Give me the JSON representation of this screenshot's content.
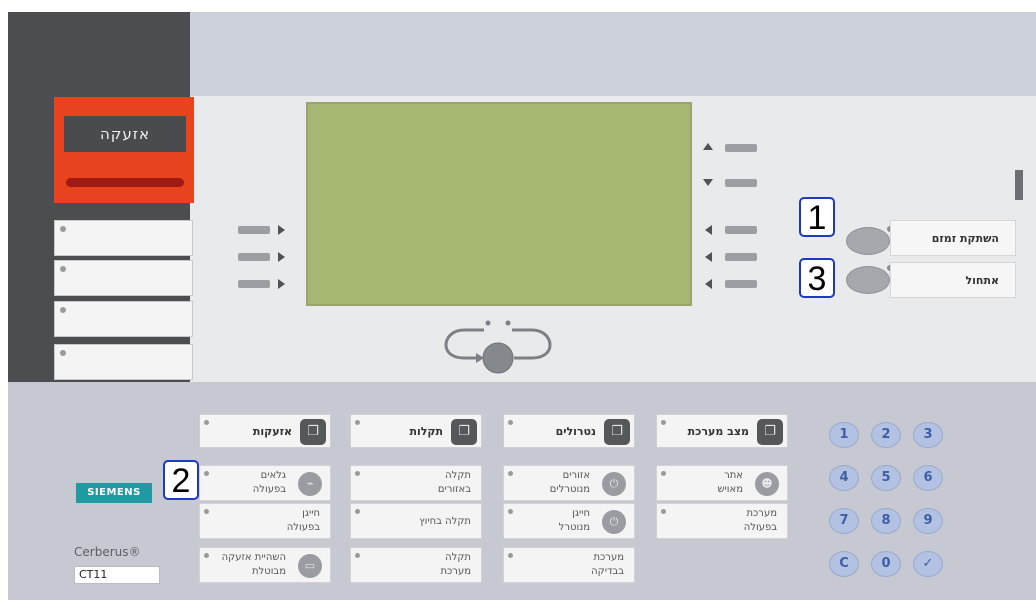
{
  "colors": {
    "panel_top": "#cdd1da",
    "lcd_green": "#a6b673",
    "alarm_red": "#e8421e",
    "callout_border": "#1d3bbf",
    "brand_teal": "#1f9aa3",
    "keypad_blue": "#b3c2e3"
  },
  "alarm": {
    "label": "אזעקה"
  },
  "function_buttons": [
    {
      "label": "השתקת זמזם",
      "callout": "1"
    },
    {
      "label": "אתחול",
      "callout": "3"
    }
  ],
  "categories": [
    {
      "title": "אזעקות",
      "icon": "alarm-category-icon",
      "buttons": [
        {
          "text": "גלאים\nבפעולה",
          "icon": "detector-icon"
        },
        {
          "text": "חייגן\nבפעולה"
        },
        {
          "text": "השהיית אזעקה\nמבוטלת",
          "icon": "delay-icon"
        }
      ],
      "callout": "2"
    },
    {
      "title": "תקלות",
      "icon": "fault-category-icon",
      "buttons": [
        {
          "text": "תקלה\nבאזורים"
        },
        {
          "text": "תקלה בחיוץ"
        },
        {
          "text": "תקלה\nמערכת"
        }
      ]
    },
    {
      "title": "נטרולים",
      "icon": "disable-category-icon",
      "buttons": [
        {
          "text": "אזורים\nמנוטרלים",
          "icon": "power-icon"
        },
        {
          "text": "חייגן\nמנוטרל",
          "icon": "power-icon"
        },
        {
          "text": "מערכת\nבבדיקה"
        }
      ]
    },
    {
      "title": "מצב מערכת",
      "icon": "system-state-icon",
      "buttons": [
        {
          "text": "אתר\nמאויש",
          "icon": "person-icon"
        },
        {
          "text": "מערכת\nבפעולה"
        }
      ]
    }
  ],
  "keypad": [
    "1",
    "2",
    "3",
    "4",
    "5",
    "6",
    "7",
    "8",
    "9",
    "C",
    "0",
    "✓"
  ],
  "brand": {
    "name": "SIEMENS",
    "product": "Cerberus®",
    "model": "CT11"
  }
}
